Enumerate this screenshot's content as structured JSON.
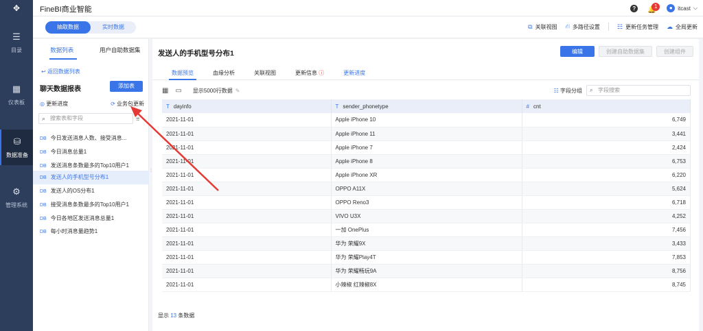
{
  "app": {
    "title": "FineBI商业智能"
  },
  "topbar": {
    "badge_count": "1",
    "user_name": "itcast"
  },
  "leftnav": [
    {
      "label": "目录",
      "icon": "menu-icon"
    },
    {
      "label": "仪表板",
      "icon": "dashboard-icon"
    },
    {
      "label": "数据准备",
      "icon": "database-icon"
    },
    {
      "label": "管理系统",
      "icon": "gear-icon"
    }
  ],
  "subbar": {
    "mode_extract": "抽取数据",
    "mode_realtime": "实时数据",
    "link_view": "关联视图",
    "multipath": "多路径设置",
    "task_manage": "更新任务管理",
    "global_update": "全局更新"
  },
  "list_panel": {
    "tab_data_list": "数据列表",
    "tab_self_service": "用户自助数据集",
    "back": "返回数据列表",
    "title": "聊天数据报表",
    "add_table": "添加表",
    "update_progress": "更新进度",
    "pkg_update": "业务包更新",
    "search_placeholder": "搜索表和字段",
    "items": [
      {
        "label": "今日发送消息人数、接受消息..."
      },
      {
        "label": "今日消息总量1"
      },
      {
        "label": "发送消息条数最多的Top10用户1"
      },
      {
        "label": "发送人的手机型号分布1"
      },
      {
        "label": "发送人的OS分布1"
      },
      {
        "label": "接受消息条数最多的Top10用户1"
      },
      {
        "label": "今日各地区发送消息总量1"
      },
      {
        "label": "每小时消息量趋势1"
      }
    ],
    "db_tag": "DB"
  },
  "main": {
    "title": "发送人的手机型号分布1",
    "btn_edit": "编辑",
    "btn_create_self": "创建自助数据集",
    "btn_create_component": "创建组件",
    "tabs": {
      "preview": "数据预览",
      "lineage": "血缘分析",
      "related": "关联视图",
      "update_info": "更新信息",
      "update_progress": "更新进度"
    },
    "rows_shown": "显示5000行数据",
    "field_group": "字段分组",
    "field_search_placeholder": "字段搜索",
    "columns": [
      {
        "type": "T",
        "name": "dayinfo"
      },
      {
        "type": "T",
        "name": "sender_phonetype"
      },
      {
        "type": "#",
        "name": "cnt"
      }
    ],
    "rows": [
      [
        "2021-11-01",
        "Apple iPhone 10",
        "6,749"
      ],
      [
        "2021-11-01",
        "Apple iPhone 11",
        "3,441"
      ],
      [
        "2021-11-01",
        "Apple iPhone 7",
        "2,424"
      ],
      [
        "2021-11-01",
        "Apple iPhone 8",
        "6,753"
      ],
      [
        "2021-11-01",
        "Apple iPhone XR",
        "6,220"
      ],
      [
        "2021-11-01",
        "OPPO A11X",
        "5,624"
      ],
      [
        "2021-11-01",
        "OPPO Reno3",
        "6,718"
      ],
      [
        "2021-11-01",
        "VIVO U3X",
        "4,252"
      ],
      [
        "2021-11-01",
        "一加 OnePlus",
        "7,456"
      ],
      [
        "2021-11-01",
        "华为 荣耀9X",
        "3,433"
      ],
      [
        "2021-11-01",
        "华为 荣耀Play4T",
        "7,853"
      ],
      [
        "2021-11-01",
        "华为 荣耀畅玩9A",
        "8,756"
      ],
      [
        "2021-11-01",
        "小辣椒 红辣椒8X",
        "8,745"
      ]
    ],
    "footer_prefix": "显示",
    "footer_count": "13",
    "footer_suffix": "条数据"
  },
  "colors": {
    "accent": "#3975e8",
    "nav_bg": "#2d3e5c",
    "arrow": "#e53935"
  }
}
